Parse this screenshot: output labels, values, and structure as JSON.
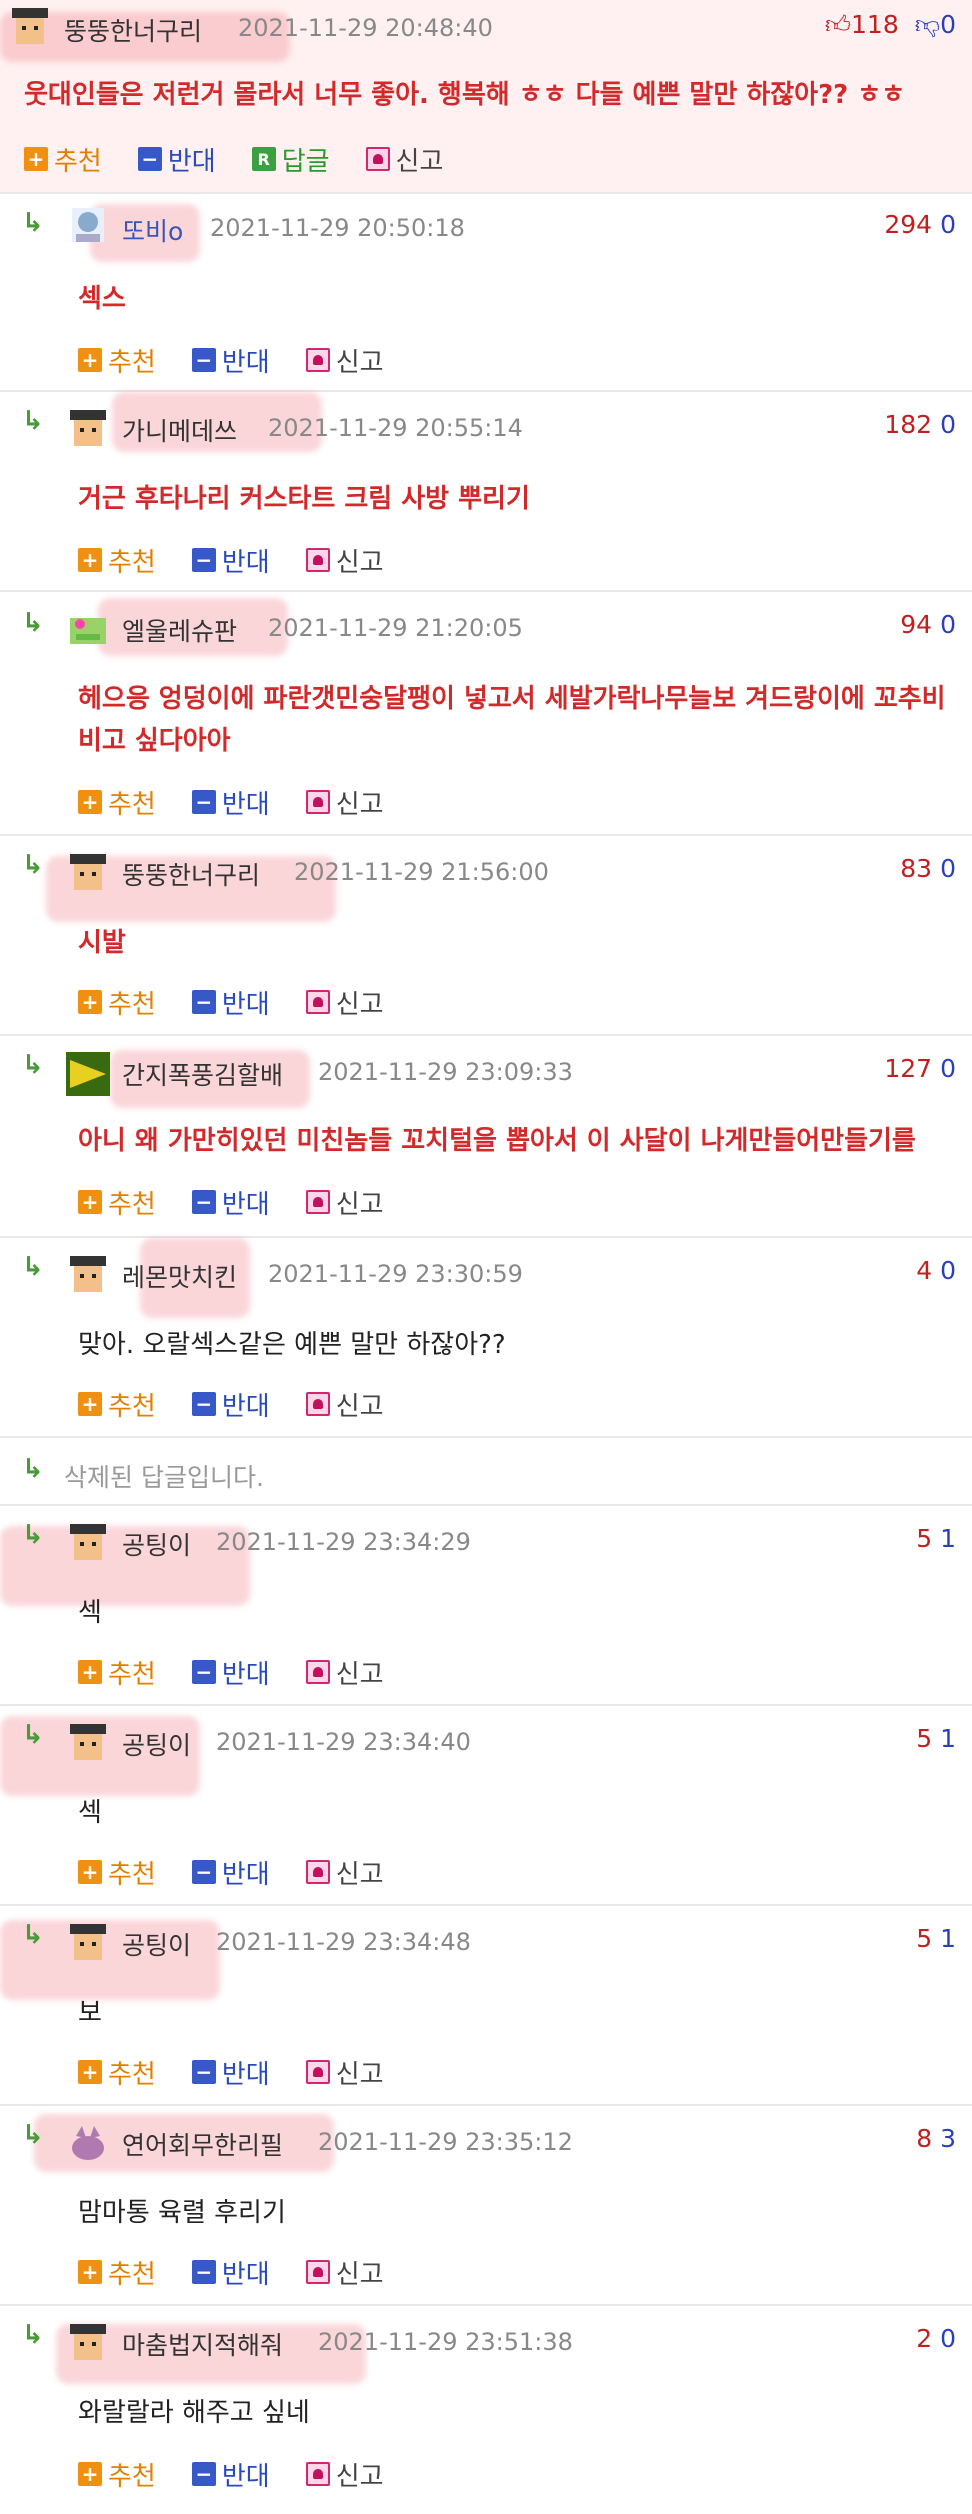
{
  "top": {
    "nick": "뚱뚱한너구리",
    "time": "2021-11-29 20:48:40",
    "up": "118",
    "down": "0",
    "text": "웃대인들은 저런거 몰라서 너무 좋아. 행복해 ㅎㅎ 다들 예쁜 말만 하잖아?? ㅎㅎ",
    "actions": {
      "recommend": "추천",
      "oppose": "반대",
      "reply": "답글",
      "report": "신고"
    }
  },
  "labels": {
    "recommend": "추천",
    "oppose": "반대",
    "report": "신고",
    "deleted": "삭제된 답글입니다."
  },
  "comments": [
    {
      "nick": "또비o",
      "time": "2021-11-29 20:50:18",
      "up": "294",
      "down": "0",
      "text": "섹스"
    },
    {
      "nick": "가니메데쓰",
      "time": "2021-11-29 20:55:14",
      "up": "182",
      "down": "0",
      "text": "거근 후타나리 커스타트 크림 사방 뿌리기"
    },
    {
      "nick": "엘울레슈판",
      "time": "2021-11-29 21:20:05",
      "up": "94",
      "down": "0",
      "text": "헤으응 엉덩이에 파란갯민숭달팽이 넣고서 세발가락나무늘보 겨드랑이에 꼬추비비고 싶다아아"
    },
    {
      "nick": "뚱뚱한너구리",
      "time": "2021-11-29 21:56:00",
      "up": "83",
      "down": "0",
      "text": "시발"
    },
    {
      "nick": "간지폭풍김할배",
      "time": "2021-11-29 23:09:33",
      "up": "127",
      "down": "0",
      "text": "아니 왜 가만히있던 미친놈들 꼬치털을 뽑아서 이 사달이 나게만들어만들기를"
    },
    {
      "nick": "레몬맛치킨",
      "time": "2021-11-29 23:30:59",
      "up": "4",
      "down": "0",
      "text": "맞아. 오랄섹스같은 예쁜 말만 하잖아??"
    },
    {
      "nick": "공팅이",
      "time": "2021-11-29 23:34:29",
      "up": "5",
      "down": "1",
      "text": "섹"
    },
    {
      "nick": "공팅이",
      "time": "2021-11-29 23:34:40",
      "up": "5",
      "down": "1",
      "text": "섹"
    },
    {
      "nick": "공팅이",
      "time": "2021-11-29 23:34:48",
      "up": "5",
      "down": "1",
      "text": "보"
    },
    {
      "nick": "연어회무한리필",
      "time": "2021-11-29 23:35:12",
      "up": "8",
      "down": "3",
      "text": "맘마통 육렬 후리기"
    },
    {
      "nick": "마춤법지적해줘",
      "time": "2021-11-29 23:51:38",
      "up": "2",
      "down": "0",
      "text": "와랄랄라 해주고 싶네"
    }
  ]
}
